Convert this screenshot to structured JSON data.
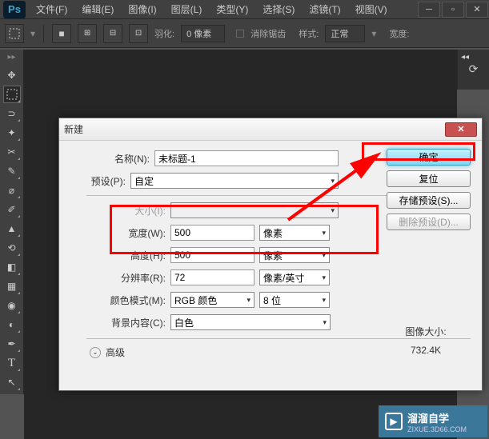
{
  "menu": {
    "items": [
      "文件(F)",
      "编辑(E)",
      "图像(I)",
      "图层(L)",
      "类型(Y)",
      "选择(S)",
      "滤镜(T)",
      "视图(V)"
    ]
  },
  "options": {
    "feather_label": "羽化:",
    "feather_value": "0 像素",
    "antialias": "消除锯齿",
    "style_label": "样式:",
    "style_value": "正常",
    "width_label": "宽度:"
  },
  "dialog": {
    "title": "新建",
    "name_label": "名称(N):",
    "name_value": "未标题-1",
    "preset_label": "预设(P):",
    "preset_value": "自定",
    "size_label": "大小(I):",
    "width_label": "宽度(W):",
    "width_value": "500",
    "width_unit": "像素",
    "height_label": "高度(H):",
    "height_value": "500",
    "height_unit": "像素",
    "res_label": "分辨率(R):",
    "res_value": "72",
    "res_unit": "像素/英寸",
    "mode_label": "颜色模式(M):",
    "mode_value": "RGB 颜色",
    "depth_value": "8 位",
    "bg_label": "背景内容(C):",
    "bg_value": "白色",
    "advanced": "高级",
    "ok": "确定",
    "reset": "复位",
    "save_preset": "存储预设(S)...",
    "delete_preset": "删除预设(D)...",
    "image_size_label": "图像大小:",
    "image_size_value": "732.4K"
  },
  "watermark": {
    "line1": "溜溜自学",
    "line2": "ZIXUE.3D66.COM"
  }
}
